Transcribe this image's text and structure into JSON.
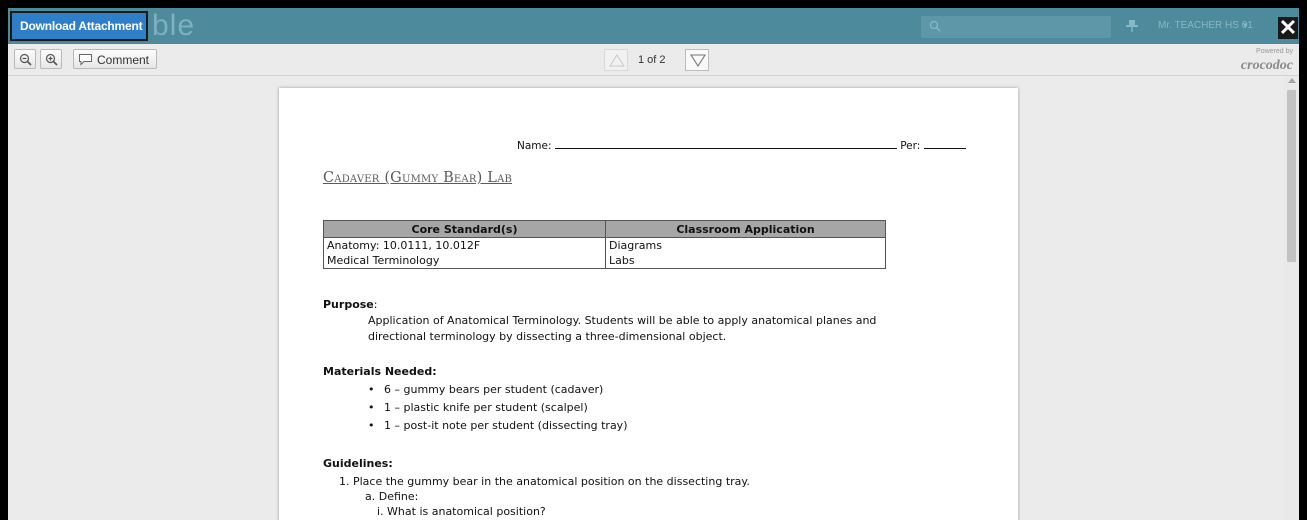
{
  "topbar": {
    "download_label": "Download Attachment",
    "ghost_logo": "ble",
    "user_label": "Mr. TEACHER HS 01",
    "caret": "▾",
    "close": "✕"
  },
  "toolbar": {
    "comment_label": "Comment",
    "page_indicator": "1 of 2",
    "powered_small": "Powered by",
    "powered_brand": "crocodoc"
  },
  "document": {
    "name_label": "Name:",
    "per_label": "Per:",
    "title": "Cadaver (Gummy Bear) Lab",
    "table": {
      "headers": [
        "Core Standard(s)",
        "Classroom Application"
      ],
      "rows": [
        [
          "Anatomy: 10.0111, 10.012F",
          "Diagrams"
        ],
        [
          "Medical Terminology",
          "Labs"
        ]
      ]
    },
    "purpose_heading": "Purpose",
    "purpose_colon": ":",
    "purpose_text": "Application of Anatomical Terminology. Students will be able to apply anatomical planes and directional terminology by dissecting a three-dimensional object.",
    "materials_heading": "Materials Needed:",
    "materials": [
      "6 – gummy bears per student (cadaver)",
      "1 – plastic knife per student (scalpel)",
      "1 – post-it note per student (dissecting tray)"
    ],
    "guidelines_heading": "Guidelines:",
    "guidelines": {
      "step1": "1.  Place the gummy bear in the anatomical position on the dissecting tray.",
      "step1a": "a.  Define:",
      "step1ai": "i.  What is anatomical position?"
    }
  }
}
